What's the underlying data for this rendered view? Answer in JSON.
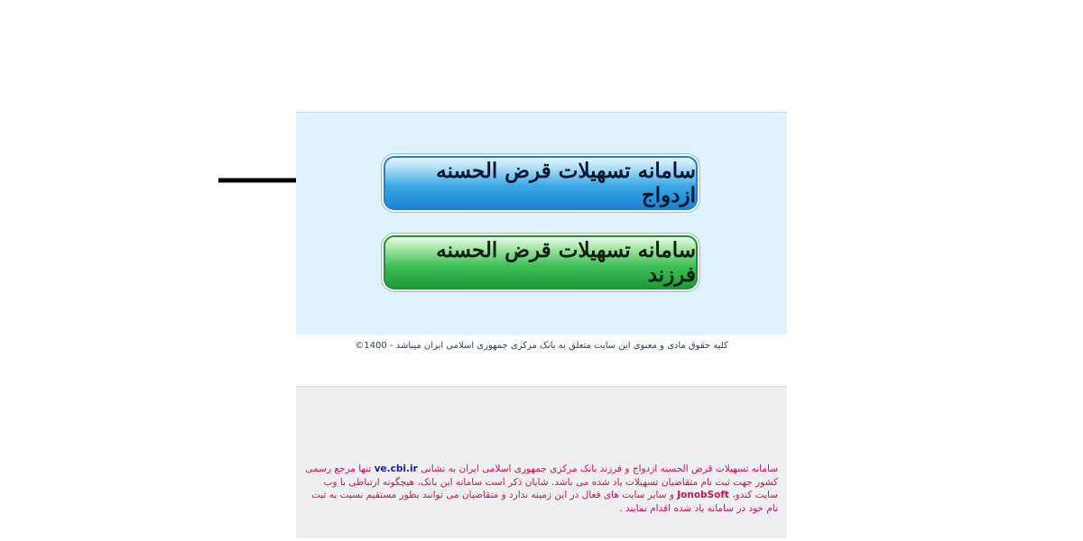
{
  "buttons": {
    "marriage_label": "سامانه تسهیلات قرض الحسنه ازدواج",
    "child_label": "سامانه تسهیلات قرض الحسنه فرزند"
  },
  "footer": {
    "copyright": "کلیه حقوق مادی و معنوی این سایت متعلق به بانک مرکزی جمهوری اسلامی ایران میباشد - 1400©"
  },
  "info": {
    "part1": "سامانه تسهیلات قرض الحسنه ازدواج و فرزند بانک مرکزی جمهوری اسلامی ایران به نشانی ",
    "link": "ve.cbi.ir",
    "part2": " تنها مرجع رسمی کشور جهت ثبت نام متقاضیان تسهیلات یاد شده می باشد. شایان ذکر است سامانه این بانک، هیچگونه ارتباطی با وب سایت کندو، ",
    "brand": "JonobSoft",
    "part3": " و سایر سایت های فعال در این زمینه ندارد و متقاضیان می توانند بطور مستقیم نسبت به ثبت نام خود در سامانه یاد شده اقدام نمایند ."
  },
  "colors": {
    "panel_blue": "#dff2fd",
    "panel_grey": "#efefef",
    "info_text": "#c2145f",
    "link": "#1a1aa8"
  },
  "icons": {
    "pointer": "arrow-right-icon"
  }
}
